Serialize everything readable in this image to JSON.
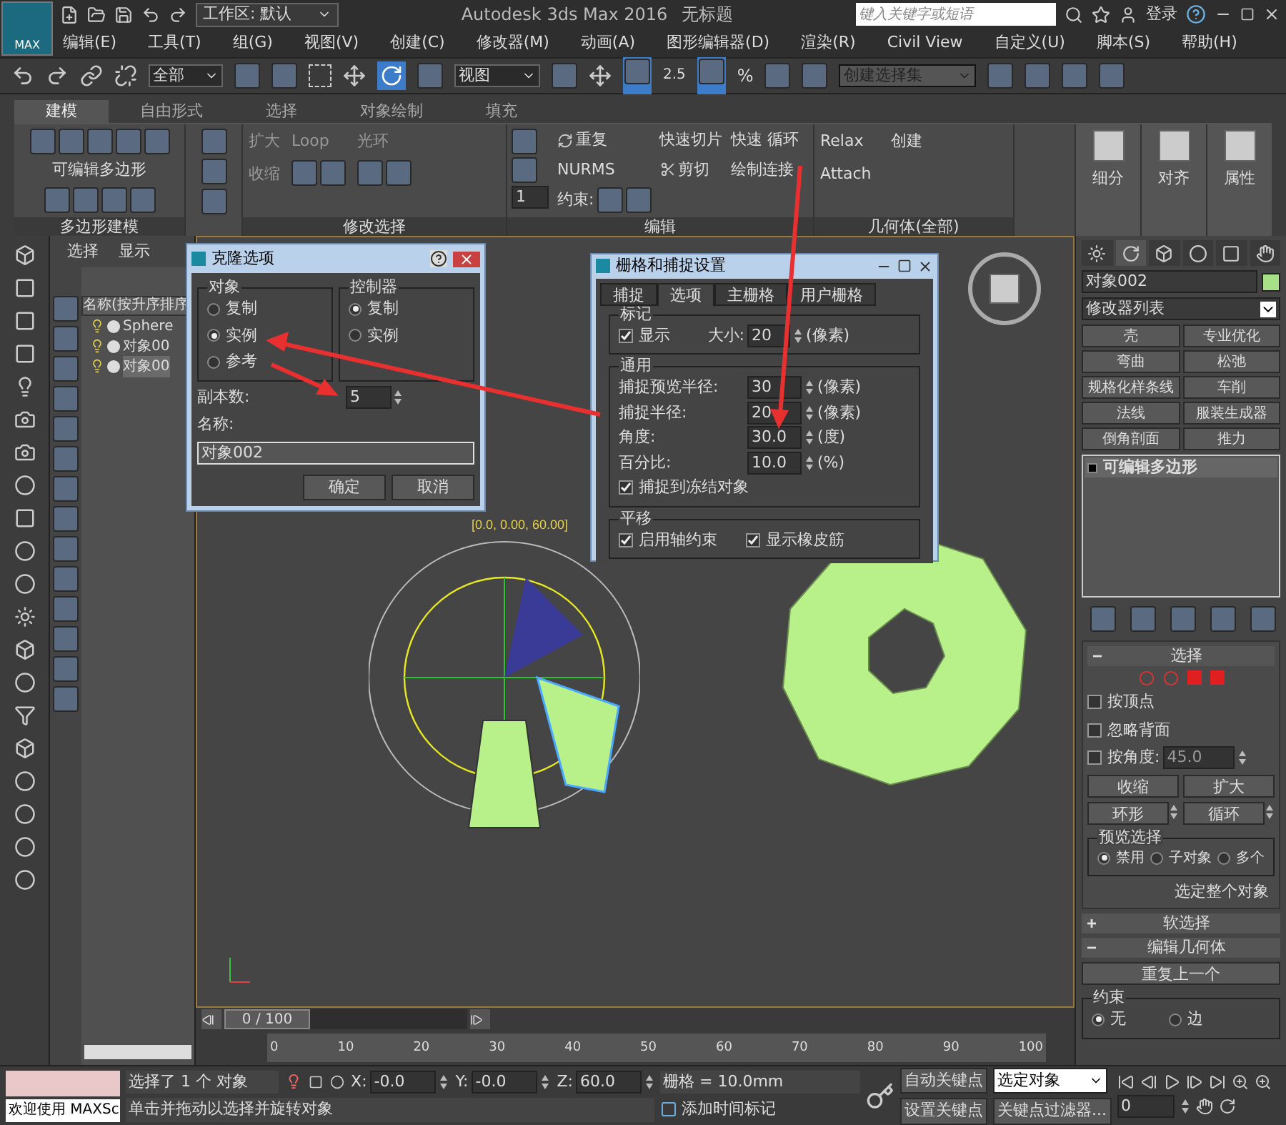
{
  "title_bar": {
    "logo": "MAX",
    "workspace": "工作区: 默认",
    "title": "Autodesk 3ds Max 2016",
    "document": "无标题",
    "search": {
      "placeholder": "键入关键字或短语"
    },
    "sign_in": "登录"
  },
  "menu": [
    "编辑(E)",
    "工具(T)",
    "组(G)",
    "视图(V)",
    "创建(C)",
    "修改器(M)",
    "动画(A)",
    "图形编辑器(D)",
    "渲染(R)",
    "Civil View",
    "自定义(U)",
    "脚本(S)",
    "帮助(H)"
  ],
  "toolbar": {
    "selection_filter": "全部",
    "coordinate_system": "视图",
    "angle_snap": "2.5",
    "percent_snap": "%",
    "named_selection": "创建选择集"
  },
  "ribbon": {
    "tabs": [
      {
        "label": "建模",
        "selected": true
      },
      {
        "label": "自由形式",
        "selected": false
      },
      {
        "label": "选择",
        "selected": false
      },
      {
        "label": "对象绘制",
        "selected": false
      },
      {
        "label": "填充",
        "selected": false
      }
    ],
    "polygon_modeling": {
      "label": "可编辑多边形",
      "footer": "多边形建模"
    },
    "modify_selection": {
      "grow": "扩大",
      "shrink": "收缩",
      "loop": "Loop",
      "ring": "光环",
      "footer": "修改选择"
    },
    "edit": {
      "spinner": "1",
      "repeat": "重复",
      "nurms": "NURMS",
      "constraints": "约束:",
      "quick_slice": "快速切片",
      "cut": "剪切",
      "quick_loop": "快速 循环",
      "paint_connect": "绘制连接",
      "footer": "编辑"
    },
    "geometry": {
      "relax": "Relax",
      "attach": "Attach",
      "create": "创建",
      "footer": "几何体(全部)"
    },
    "big_buttons": [
      "细分",
      "对齐",
      "属性"
    ]
  },
  "scene_explorer": {
    "menu": [
      "选择",
      "显示"
    ],
    "column": "名称(按升序排序",
    "items": [
      {
        "name": "Sphere",
        "selected": false
      },
      {
        "name": "对象00",
        "selected": false
      },
      {
        "name": "对象00",
        "selected": true
      }
    ]
  },
  "viewport": {
    "coordinates": "[0.0, 0.00, 60.00]",
    "time_slider": {
      "label": "0 / 100",
      "level": 0
    },
    "ticks": [
      "0",
      "10",
      "20",
      "30",
      "40",
      "50",
      "60",
      "70",
      "80",
      "90",
      "100"
    ]
  },
  "clone_dialog": {
    "title": "克隆选项",
    "object_group": {
      "label": "对象",
      "options": [
        {
          "label": "复制",
          "selected": false
        },
        {
          "label": "实例",
          "selected": true
        },
        {
          "label": "参考",
          "selected": false
        }
      ]
    },
    "controller_group": {
      "label": "控制器",
      "options": [
        {
          "label": "复制",
          "selected": true
        },
        {
          "label": "实例",
          "selected": false
        }
      ]
    },
    "copies_label": "副本数:",
    "copies": "5",
    "name_label": "名称:",
    "name": "对象002",
    "buttons": [
      "确定",
      "取消"
    ]
  },
  "snap_dialog": {
    "title": "栅格和捕捉设置",
    "tabs": [
      {
        "label": "捕捉",
        "selected": false
      },
      {
        "label": "选项",
        "selected": true
      },
      {
        "label": "主栅格",
        "selected": false
      },
      {
        "label": "用户栅格",
        "selected": false
      }
    ],
    "markers": {
      "label": "标记",
      "display": {
        "label": "显示",
        "checked": true
      },
      "size_label": "大小:",
      "size": "20",
      "size_unit": "(像素)"
    },
    "general": {
      "label": "通用",
      "fields": [
        {
          "label": "捕捉预览半径:",
          "value": "30",
          "unit": "(像素)"
        },
        {
          "label": "捕捉半径:",
          "value": "20",
          "unit": "(像素)"
        },
        {
          "label": "角度:",
          "value": "30.0",
          "unit": "(度)"
        },
        {
          "label": "百分比:",
          "value": "10.0",
          "unit": "(%)"
        }
      ],
      "snap_frozen": {
        "label": "捕捉到冻结对象",
        "checked": true
      }
    },
    "translation": {
      "label": "平移",
      "options": [
        {
          "label": "启用轴约束",
          "checked": true
        },
        {
          "label": "显示橡皮筋",
          "checked": true
        }
      ]
    }
  },
  "command_panel": {
    "object_name": "对象002",
    "color": "#a8e08a",
    "modifier_list": "修改器列表",
    "modifiers": [
      "壳",
      "专业优化",
      "弯曲",
      "松弛",
      "规格化样条线",
      "车削",
      "法线",
      "服装生成器",
      "倒角剖面",
      "推力"
    ],
    "stack": [
      {
        "name": "可编辑多边形",
        "selected": true
      }
    ],
    "selection": {
      "title": "选择",
      "expanded": true,
      "checks": [
        {
          "label": "按顶点",
          "checked": false
        },
        {
          "label": "忽略背面",
          "checked": false
        },
        {
          "label": "按角度:",
          "checked": false
        }
      ],
      "angle": "45.0",
      "buttons": [
        "收缩",
        "扩大"
      ],
      "spin_buttons": [
        "环形",
        "循环"
      ],
      "preview": {
        "label": "预览选择",
        "options": [
          {
            "label": "禁用",
            "selected": true
          },
          {
            "label": "子对象",
            "selected": false
          },
          {
            "label": "多个",
            "selected": false
          }
        ]
      },
      "select_whole": "选定整个对象"
    },
    "soft_selection": {
      "title": "软选择",
      "expanded": false
    },
    "edit_geometry": {
      "title": "编辑几何体",
      "expanded": true,
      "repeat": "重复上一个",
      "constraints": {
        "label": "约束",
        "options": [
          {
            "label": "无",
            "selected": true
          },
          {
            "label": "边",
            "selected": false
          }
        ]
      }
    }
  },
  "status": {
    "script_label": "欢迎使用 MAXSc",
    "selection": "选择了 1 个 对象",
    "prompt": "单击并拖动以选择并旋转对象",
    "coords": [
      {
        "axis": "X:",
        "value": "-0.0"
      },
      {
        "axis": "Y:",
        "value": "-0.0"
      },
      {
        "axis": "Z:",
        "value": "60.0"
      }
    ],
    "grid": "栅格 = 10.0mm",
    "add_time_tag": "添加时间标记",
    "auto_key": "自动关键点",
    "set_key": "设置关键点",
    "key_mode": "选定对象",
    "key_filters": "关键点过滤器...",
    "frame": "0"
  }
}
